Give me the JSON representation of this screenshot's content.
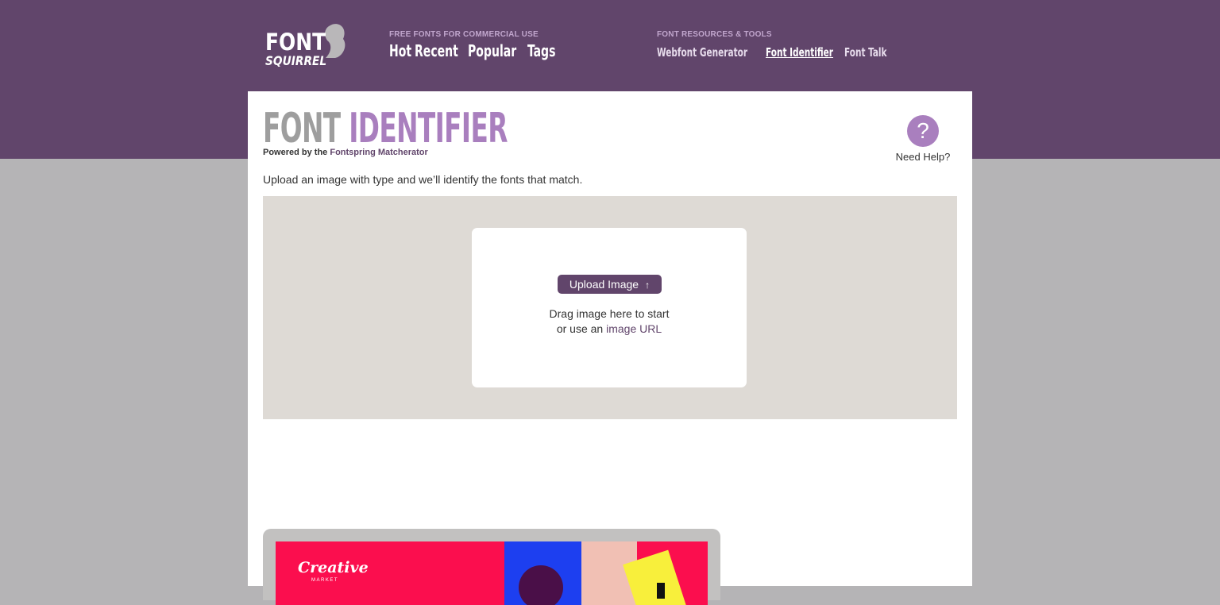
{
  "header": {
    "logo_text": "FONT SQUIRREL",
    "free_fonts": {
      "caption": "FREE FONTS FOR COMMERCIAL USE",
      "links": [
        "Hot",
        "Recent",
        "Popular",
        "Tags"
      ]
    },
    "resources": {
      "caption": "FONT RESOURCES & TOOLS",
      "links": [
        "Webfont Generator",
        "Font Identifier",
        "Font Talk"
      ],
      "active": "Font Identifier"
    }
  },
  "page": {
    "title_part1": "FONT",
    "title_part2": "IDENTIFIER",
    "powered_prefix": "Powered by the",
    "powered_link": "Fontspring Matcherator",
    "help_icon": "?",
    "help_label": "Need Help?",
    "intro": "Upload an image with type and we’ll identify the fonts that match."
  },
  "upload": {
    "button_label": "Upload Image",
    "button_icon": "↑",
    "drag_text": "Drag image here to start",
    "or_text": "or use an",
    "url_link": "image URL"
  },
  "promo": {
    "brand": "Creative",
    "sub": "MARKET"
  },
  "colors": {
    "header_bg": "#61456b",
    "accent": "#a97fbe",
    "page_bg": "#b5b4b6",
    "drop_zone_bg": "#dedad5"
  }
}
